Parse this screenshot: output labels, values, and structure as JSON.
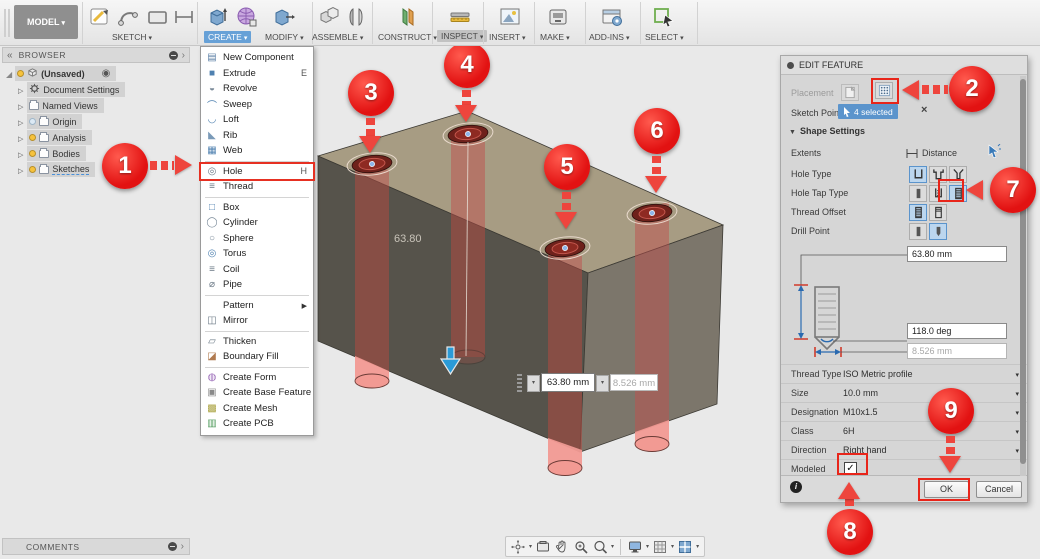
{
  "toolbar": {
    "model_label": "MODEL",
    "groups": {
      "sketch": "SKETCH",
      "create": "CREATE",
      "modify": "MODIFY",
      "assemble": "ASSEMBLE",
      "construct": "CONSTRUCT",
      "inspect": "INSPECT",
      "insert": "INSERT",
      "make": "MAKE",
      "addins": "ADD-INS",
      "select": "SELECT"
    }
  },
  "browser": {
    "title": "BROWSER",
    "items": [
      {
        "label": "(Unsaved)"
      },
      {
        "label": "Document Settings"
      },
      {
        "label": "Named Views"
      },
      {
        "label": "Origin"
      },
      {
        "label": "Analysis"
      },
      {
        "label": "Bodies"
      },
      {
        "label": "Sketches"
      }
    ]
  },
  "create_menu": {
    "items": [
      {
        "label": "New Component"
      },
      {
        "label": "Extrude",
        "shortcut": "E"
      },
      {
        "label": "Revolve"
      },
      {
        "label": "Sweep"
      },
      {
        "label": "Loft"
      },
      {
        "label": "Rib"
      },
      {
        "label": "Web"
      },
      {
        "label": "Hole",
        "shortcut": "H"
      },
      {
        "label": "Thread"
      },
      {
        "label": "Box"
      },
      {
        "label": "Cylinder"
      },
      {
        "label": "Sphere"
      },
      {
        "label": "Torus"
      },
      {
        "label": "Coil"
      },
      {
        "label": "Pipe"
      },
      {
        "label": "Pattern"
      },
      {
        "label": "Mirror"
      },
      {
        "label": "Thicken"
      },
      {
        "label": "Boundary Fill"
      },
      {
        "label": "Create Form"
      },
      {
        "label": "Create Base Feature"
      },
      {
        "label": "Create Mesh"
      },
      {
        "label": "Create PCB"
      }
    ]
  },
  "viewport": {
    "dimension_label": "63.80",
    "depth_input": "63.80 mm",
    "diameter_input": "8.526 mm"
  },
  "edit_feature": {
    "title": "EDIT FEATURE",
    "placement_label": "Placement",
    "sketch_points_label": "Sketch Points",
    "sketch_points_value": "4 selected",
    "shape_settings_label": "Shape Settings",
    "extents_label": "Extents",
    "extents_value": "Distance",
    "hole_type_label": "Hole Type",
    "hole_tap_type_label": "Hole Tap Type",
    "thread_offset_label": "Thread Offset",
    "drill_point_label": "Drill Point",
    "depth_value": "63.80 mm",
    "angle_value": "118.0 deg",
    "tip_diameter_value": "8.526 mm",
    "rows": [
      {
        "label": "Thread Type",
        "value": "ISO Metric profile"
      },
      {
        "label": "Size",
        "value": "10.0 mm"
      },
      {
        "label": "Designation",
        "value": "M10x1.5"
      },
      {
        "label": "Class",
        "value": "6H"
      },
      {
        "label": "Direction",
        "value": "Right hand"
      }
    ],
    "modeled_label": "Modeled",
    "ok_label": "OK",
    "cancel_label": "Cancel"
  },
  "comments": {
    "title": "COMMENTS"
  },
  "callouts": [
    "1",
    "2",
    "3",
    "4",
    "5",
    "6",
    "7",
    "8",
    "9"
  ],
  "colors": {
    "callout_red": "#e21212",
    "highlight_red": "#e8251a",
    "selection_blue": "#5b94cc",
    "box_top": "#a79c83",
    "box_front": "#56534b",
    "box_right": "#7c766b",
    "hole_preview": "#f29a93"
  }
}
